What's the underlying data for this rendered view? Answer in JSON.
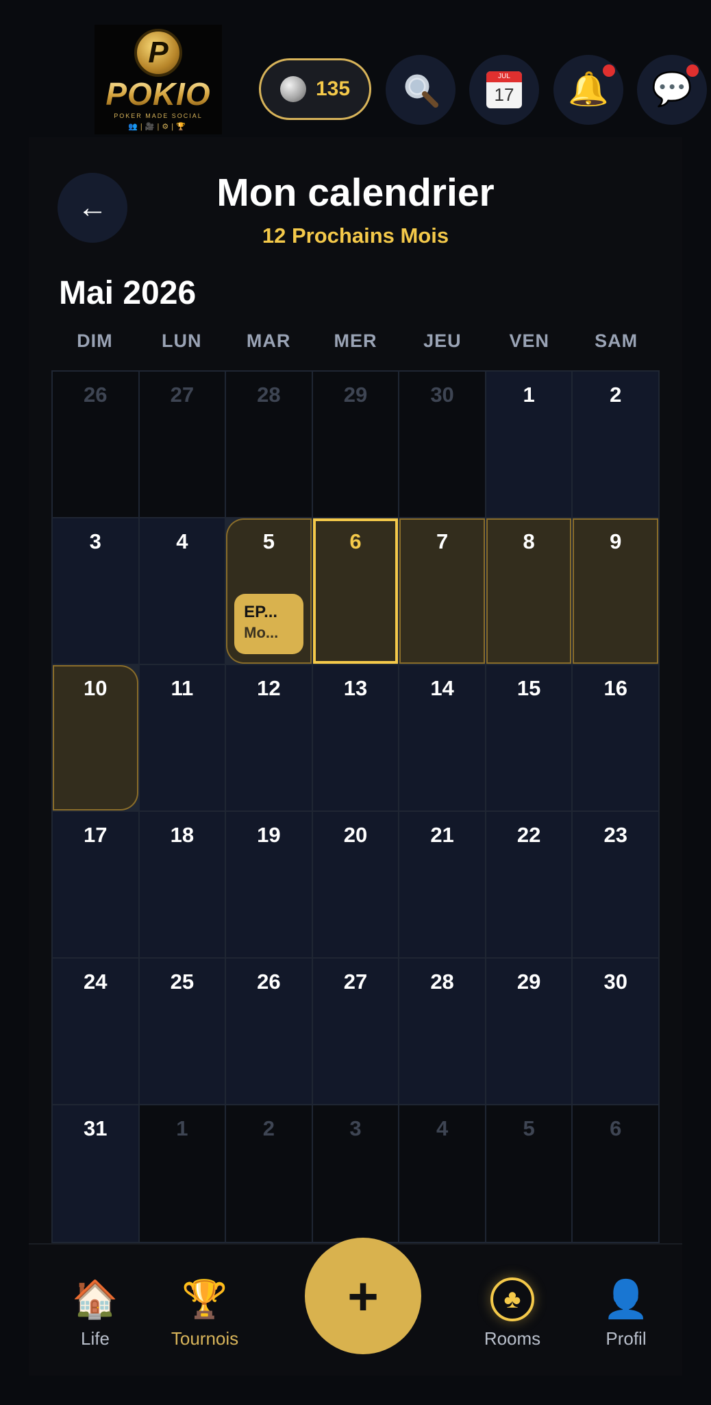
{
  "brand": {
    "name": "POKIO",
    "chip_letter": "P",
    "tagline": "POKER MADE SOCIAL",
    "icons_row": "👥|🎥|⚙|🏆"
  },
  "header": {
    "coin_count": "135",
    "calendar_month": "JUL",
    "calendar_day": "17",
    "notifications_badge": true,
    "messages_badge": true
  },
  "page": {
    "back_icon": "←",
    "title": "Mon calendrier",
    "subtitle": "12 Prochains Mois",
    "month_title": "Mai 2026"
  },
  "weekdays": [
    "DIM",
    "LUN",
    "MAR",
    "MER",
    "JEU",
    "VEN",
    "SAM"
  ],
  "days": [
    {
      "n": "26",
      "outside": true
    },
    {
      "n": "27",
      "outside": true
    },
    {
      "n": "28",
      "outside": true
    },
    {
      "n": "29",
      "outside": true
    },
    {
      "n": "30",
      "outside": true
    },
    {
      "n": "1"
    },
    {
      "n": "2"
    },
    {
      "n": "3"
    },
    {
      "n": "4"
    },
    {
      "n": "5",
      "range": "start"
    },
    {
      "n": "6",
      "range": "mid",
      "today": true
    },
    {
      "n": "7",
      "range": "mid"
    },
    {
      "n": "8",
      "range": "mid"
    },
    {
      "n": "9",
      "range": "mid"
    },
    {
      "n": "10",
      "range": "end"
    },
    {
      "n": "11"
    },
    {
      "n": "12"
    },
    {
      "n": "13"
    },
    {
      "n": "14"
    },
    {
      "n": "15"
    },
    {
      "n": "16"
    },
    {
      "n": "17"
    },
    {
      "n": "18"
    },
    {
      "n": "19"
    },
    {
      "n": "20"
    },
    {
      "n": "21"
    },
    {
      "n": "22"
    },
    {
      "n": "23"
    },
    {
      "n": "24"
    },
    {
      "n": "25"
    },
    {
      "n": "26"
    },
    {
      "n": "27"
    },
    {
      "n": "28"
    },
    {
      "n": "29"
    },
    {
      "n": "30"
    },
    {
      "n": "31"
    },
    {
      "n": "1",
      "outside": true
    },
    {
      "n": "2",
      "outside": true
    },
    {
      "n": "3",
      "outside": true
    },
    {
      "n": "4",
      "outside": true
    },
    {
      "n": "5",
      "outside": true
    },
    {
      "n": "6",
      "outside": true
    }
  ],
  "event": {
    "day_index": 9,
    "line1": "EP...",
    "line2": "Mo..."
  },
  "nav": {
    "life": {
      "icon": "🏠",
      "label": "Life"
    },
    "tournois": {
      "icon": "🏆",
      "label": "Tournois"
    },
    "add": {
      "icon": "+"
    },
    "rooms": {
      "icon": "♣",
      "label": "Rooms"
    },
    "profil": {
      "icon": "👤",
      "label": "Profil"
    }
  },
  "colors": {
    "accent": "#f4c94a",
    "accent_dark": "#d9b24e",
    "cell": "#121829",
    "range_fill": "#332d1d",
    "badge": "#e0302f"
  }
}
